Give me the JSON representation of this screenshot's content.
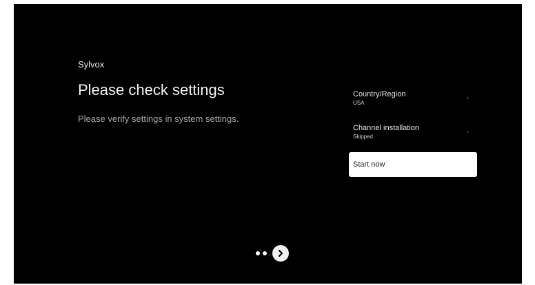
{
  "brand": "Sylvox",
  "title": "Please check settings",
  "subtitle": "Please verify settings in system settings.",
  "menu": {
    "items": [
      {
        "label": "Country/Region",
        "value": "USA",
        "icon": "chevron-right-icon"
      },
      {
        "label": "Channel installation",
        "value": "Skipped",
        "icon": "chevron-right-icon"
      },
      {
        "label": "Start now",
        "focused": true
      }
    ]
  },
  "pager": {
    "dots": 2,
    "next_icon": "arrow-right-circle-icon"
  },
  "colors": {
    "background": "#000000",
    "focus": "#ffffff",
    "text": "#ffffff",
    "muted": "#a8a8a8"
  }
}
